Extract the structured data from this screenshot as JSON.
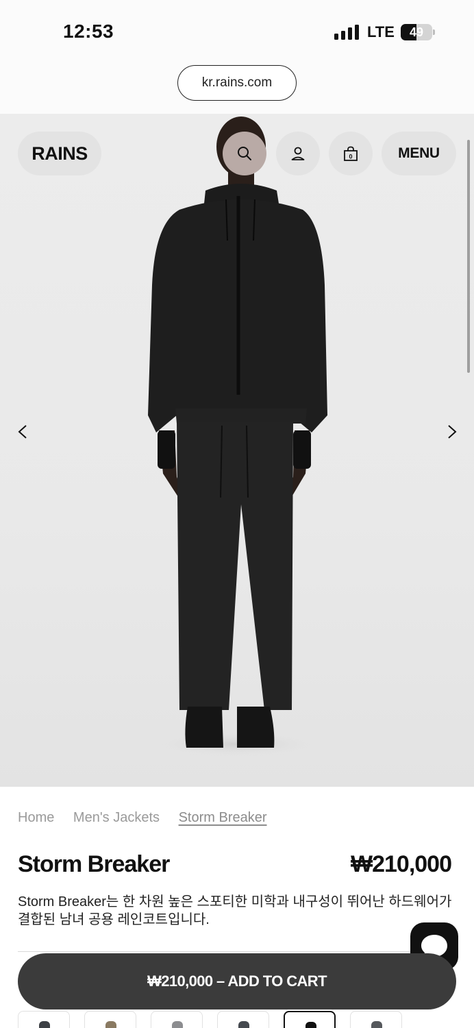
{
  "status_bar": {
    "time": "12:53",
    "network": "LTE",
    "battery": "49"
  },
  "browser": {
    "url": "kr.rains.com"
  },
  "header": {
    "logo": "RAINS",
    "menu_label": "MENU",
    "cart_count": "0"
  },
  "breadcrumb": [
    "Home",
    "Men's Jackets",
    "Storm Breaker"
  ],
  "product": {
    "title": "Storm Breaker",
    "price": "₩210,000",
    "description": "Storm Breaker는 한 차원 높은 스포티한 미학과 내구성이 뛰어난 하드웨어가 결합된 남녀 공용 레인코트입니다."
  },
  "cta": {
    "add_to_cart": "₩210,000 – ADD TO CART"
  },
  "swatches": [
    {
      "color": "#3d4045",
      "selected": false
    },
    {
      "color": "#8a7a62",
      "selected": false
    },
    {
      "color": "#8c8d90",
      "selected": false
    },
    {
      "color": "#45494f",
      "selected": false
    },
    {
      "color": "#111111",
      "selected": true
    },
    {
      "color": "#55585c",
      "selected": false
    }
  ],
  "colors": {
    "accent_button": "#3b3b3b",
    "nav_pill": "#e3e3e3"
  }
}
